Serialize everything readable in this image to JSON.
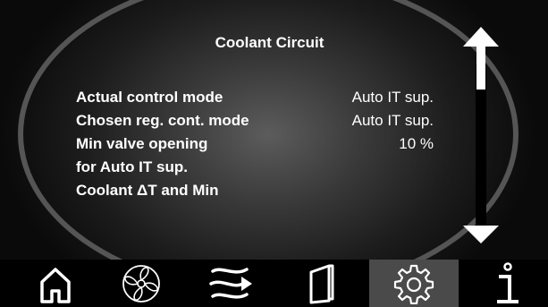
{
  "screen": {
    "title": "Coolant Circuit"
  },
  "settings": [
    {
      "label": "Actual control mode",
      "value": "Auto IT sup."
    },
    {
      "label": "Chosen reg. cont. mode",
      "value": "Auto IT sup."
    },
    {
      "label": "Min valve opening",
      "value": "10 %"
    },
    {
      "label": "for Auto IT sup.",
      "value": ""
    },
    {
      "label": "Coolant ΔT and Min",
      "value": ""
    }
  ],
  "navigation": [
    {
      "icon": "home-icon",
      "active": false
    },
    {
      "icon": "fan-icon",
      "active": false
    },
    {
      "icon": "airflow-icon",
      "active": false
    },
    {
      "icon": "door-icon",
      "active": false
    },
    {
      "icon": "gear-icon",
      "active": true
    },
    {
      "icon": "info-icon",
      "active": false
    }
  ],
  "colors": {
    "text": "#ffffff",
    "nav_active": "#4a4a4a",
    "background": "#000000"
  }
}
